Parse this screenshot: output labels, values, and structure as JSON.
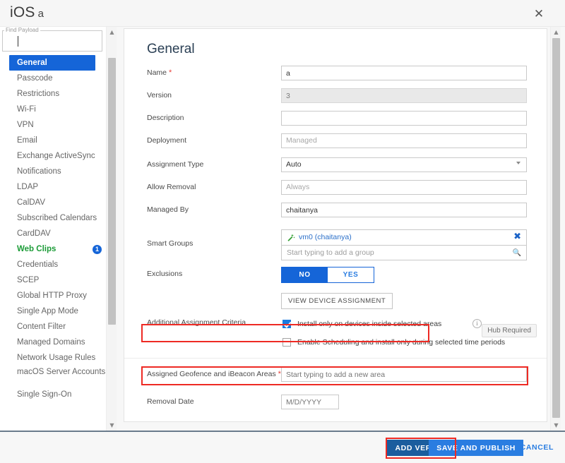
{
  "window": {
    "platform": "iOS",
    "profile_name": "a",
    "close_icon": "close-icon"
  },
  "sidebar": {
    "search": {
      "label": "Find Payload",
      "value": "",
      "placeholder": ""
    },
    "items": [
      {
        "label": "General",
        "state": "active"
      },
      {
        "label": "Passcode",
        "state": "normal"
      },
      {
        "label": "Restrictions",
        "state": "normal"
      },
      {
        "label": "Wi-Fi",
        "state": "normal"
      },
      {
        "label": "VPN",
        "state": "normal"
      },
      {
        "label": "Email",
        "state": "normal"
      },
      {
        "label": "Exchange ActiveSync",
        "state": "normal"
      },
      {
        "label": "Notifications",
        "state": "normal"
      },
      {
        "label": "LDAP",
        "state": "normal"
      },
      {
        "label": "CalDAV",
        "state": "normal"
      },
      {
        "label": "Subscribed Calendars",
        "state": "normal"
      },
      {
        "label": "CardDAV",
        "state": "normal"
      },
      {
        "label": "Web Clips",
        "state": "configured",
        "badge": "1"
      },
      {
        "label": "Credentials",
        "state": "normal"
      },
      {
        "label": "SCEP",
        "state": "normal"
      },
      {
        "label": "Global HTTP Proxy",
        "state": "normal"
      },
      {
        "label": "Single App Mode",
        "state": "normal"
      },
      {
        "label": "Content Filter",
        "state": "normal"
      },
      {
        "label": "Managed Domains",
        "state": "normal"
      },
      {
        "label": "Network Usage Rules",
        "state": "normal"
      },
      {
        "label": "macOS Server Accounts",
        "state": "normal"
      },
      {
        "label": "Single Sign-On",
        "state": "normal"
      }
    ]
  },
  "main": {
    "heading": "General",
    "fields": {
      "name": {
        "label": "Name",
        "required": "*",
        "value": "a"
      },
      "version": {
        "label": "Version",
        "value": "3"
      },
      "description": {
        "label": "Description",
        "value": ""
      },
      "deployment": {
        "label": "Deployment",
        "value": "Managed"
      },
      "assignment_type": {
        "label": "Assignment Type",
        "value": "Auto"
      },
      "allow_removal": {
        "label": "Allow Removal",
        "value": "Always"
      },
      "managed_by": {
        "label": "Managed By",
        "value": "chaitanya"
      },
      "smart_groups": {
        "label": "Smart Groups",
        "chip": "vm0 (chaitanya)",
        "chip_icon": "magic-wand-icon",
        "remove_icon": "remove-chip-icon",
        "placeholder": "Start typing to add a group",
        "search_icon": "search-icon"
      },
      "exclusions": {
        "label": "Exclusions",
        "options": [
          "NO",
          "YES"
        ],
        "selected": "NO"
      },
      "view_device_assignment": {
        "label": "VIEW DEVICE ASSIGNMENT"
      },
      "additional_criteria": {
        "label": "Additional Assignment Criteria",
        "checkbox_areas": {
          "text": "Install only on devices inside selected areas",
          "checked": true,
          "info_icon": "info-icon"
        },
        "checkbox_schedule": {
          "text": "Enable Scheduling and install only during selected time periods",
          "checked": false
        },
        "hub_badge": "Hub Required"
      },
      "geofence": {
        "label": "Assigned Geofence and iBeacon Areas",
        "required": "*",
        "placeholder": "Start typing to add a new area",
        "value": ""
      },
      "removal_date": {
        "label": "Removal Date",
        "placeholder": "M/D/YYYY",
        "value": ""
      }
    }
  },
  "footer": {
    "add_version": "ADD VERSION",
    "save_and_publish": "SAVE AND PUBLISH",
    "cancel": "CANCEL"
  },
  "colors": {
    "accent_blue": "#1565d8",
    "link_blue": "#2a7de1",
    "dark_blue": "#1b5d9e",
    "green": "#1c9c38",
    "required_red": "#e8403a",
    "annotation_red": "#ee2a24"
  }
}
